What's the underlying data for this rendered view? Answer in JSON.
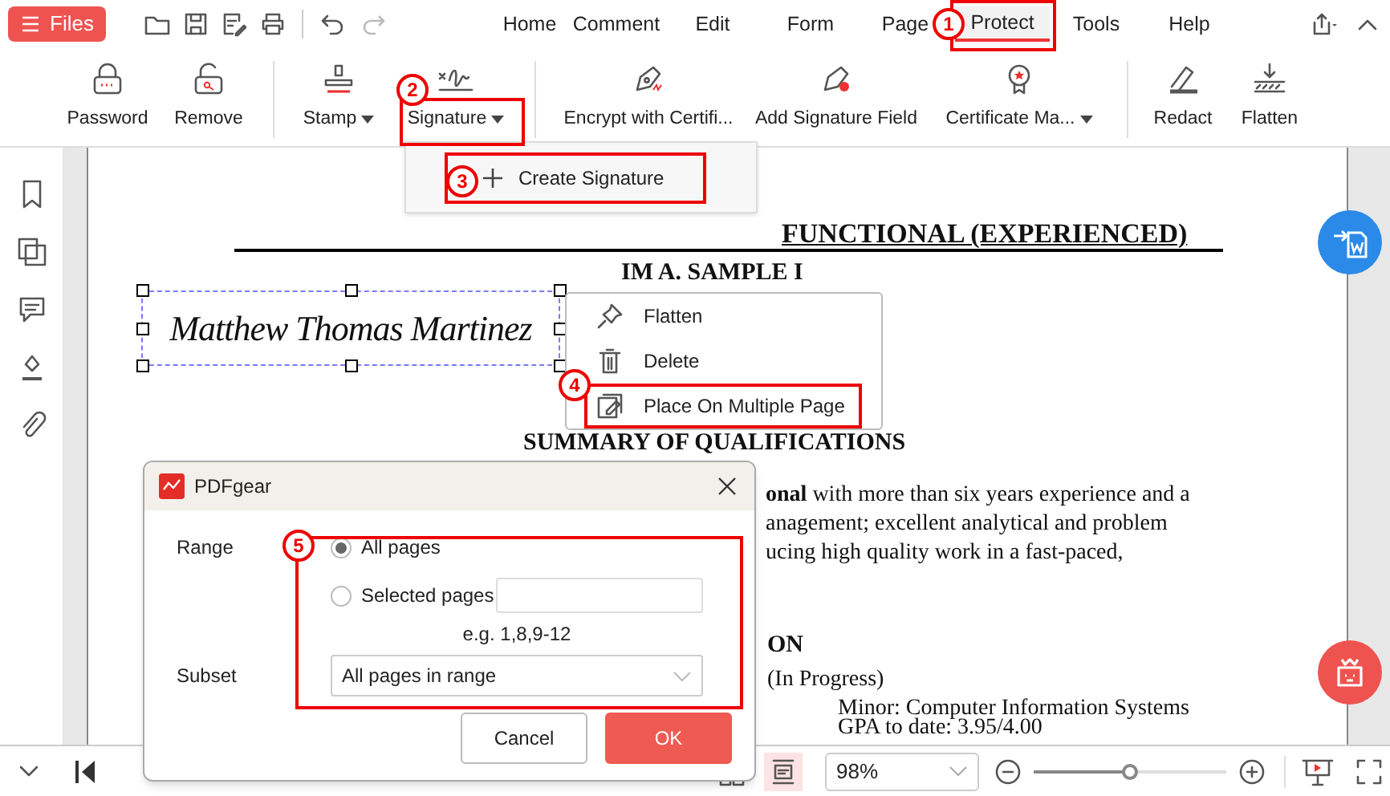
{
  "files_button": "Files",
  "menu_tabs": [
    {
      "label": "Home",
      "selected": false
    },
    {
      "label": "Comment",
      "selected": false
    },
    {
      "label": "Edit",
      "selected": false
    },
    {
      "label": "Form",
      "selected": false
    },
    {
      "label": "Page",
      "selected": false
    },
    {
      "label": "Protect",
      "selected": true
    },
    {
      "label": "Tools",
      "selected": false
    },
    {
      "label": "Help",
      "selected": false
    }
  ],
  "ribbon": [
    {
      "label": "Password",
      "dropdown": false
    },
    {
      "label": "Remove",
      "dropdown": false
    },
    {
      "label": "Stamp",
      "dropdown": true
    },
    {
      "label": "Signature",
      "dropdown": true
    },
    {
      "label": "Encrypt with Certifi...",
      "dropdown": false
    },
    {
      "label": "Add Signature Field",
      "dropdown": false
    },
    {
      "label": "Certificate Ma...",
      "dropdown": true
    },
    {
      "label": "Redact",
      "dropdown": false
    },
    {
      "label": "Flatten",
      "dropdown": false
    }
  ],
  "signature_menu": {
    "item": "Create Signature"
  },
  "document": {
    "heading": "FUNCTIONAL (EXPERIENCED)",
    "name": "IM A. SAMPLE I",
    "signature": "Matthew Thomas Martinez",
    "section": "SUMMARY OF QUALIFICATIONS",
    "lines": [
      "**onal** with more than six years experience and a",
      "anagement; excellent analytical and problem",
      "ucing high quality work in a fast-paced,"
    ],
    "section2": "ON",
    "line4": "(In Progress)",
    "minor": "Minor:  Computer Information Systems",
    "gpa": "GPA to date:  3.95/4.00"
  },
  "context_menu": [
    "Flatten",
    "Delete",
    "Place On Multiple Page"
  ],
  "dialog": {
    "title": "PDFgear",
    "range_label": "Range",
    "options": [
      {
        "label": "All pages",
        "selected": true
      },
      {
        "label": "Selected pages",
        "selected": false
      }
    ],
    "hint": "e.g. 1,8,9-12",
    "subset_label": "Subset",
    "subset_value": "All pages in range",
    "cancel": "Cancel",
    "ok": "OK"
  },
  "zoom": {
    "value": "98%",
    "level": 0.5
  },
  "callouts": [
    "1",
    "2",
    "3",
    "4",
    "5"
  ]
}
